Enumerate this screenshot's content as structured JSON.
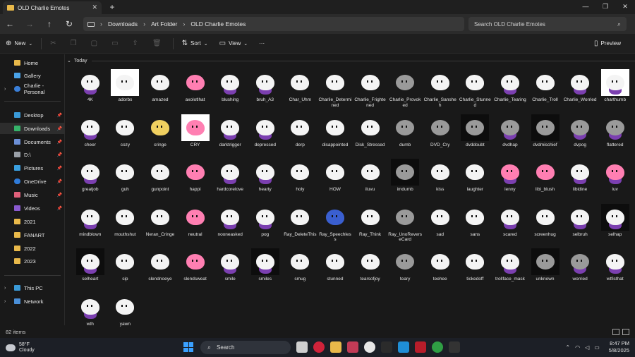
{
  "window": {
    "tab_title": "OLD Charlie Emotes",
    "new_tab": "+",
    "controls": [
      "—",
      "❐",
      "✕"
    ]
  },
  "address": {
    "breadcrumbs": [
      "Downloads",
      "Art Folder",
      "OLD Charlie Emotes"
    ],
    "search_placeholder": "Search OLD Charlie Emotes"
  },
  "toolbar": {
    "new_label": "New",
    "sort_label": "Sort",
    "view_label": "View",
    "more_label": "···",
    "preview_label": "Preview"
  },
  "sidebar": {
    "home": "Home",
    "gallery": "Gallery",
    "onedrive": "Charlie - Personal",
    "quick": [
      "Desktop",
      "Downloads",
      "Documents",
      "D:\\",
      "Pictures",
      "OneDrive",
      "Music",
      "Videos",
      "2021",
      "FANART",
      "2022",
      "2023"
    ],
    "this_pc": "This PC",
    "network": "Network"
  },
  "content": {
    "group_label": "Today",
    "files": [
      "4K",
      "adorbs",
      "amazed",
      "axolotlhat",
      "blushing",
      "bruh_A3",
      "Char_Uhm",
      "Charlie_Determined",
      "Charlie_Frightened",
      "Charlie_Provoked",
      "Charlie_Sansheh",
      "Charlie_Stunned",
      "Charlie_Tearing",
      "Charlie_Troll",
      "Charlie_Worried",
      "charthumb",
      "cheer",
      "cozy",
      "cringe",
      "CRY",
      "darktrigger",
      "depressed",
      "derp",
      "disappointed",
      "Disk_Stressed",
      "dumb",
      "DVD_Cry",
      "dvddoubt",
      "dvdhap",
      "dvdmischief",
      "dvpog",
      "flattered",
      "greatjob",
      "guh",
      "gunpoint",
      "happi",
      "hardcorelove",
      "hearty",
      "holy",
      "HOW",
      "iluvu",
      "imdumb",
      "kiss",
      "laughter",
      "lenny",
      "libi_blush",
      "libidine",
      "luv",
      "mindblown",
      "mouthshut",
      "Neran_Cringe",
      "neutral",
      "nooneasked",
      "pog",
      "Ray_DeleteThis",
      "Ray_Speechless",
      "Ray_Think",
      "Ray_UnoReverseCard",
      "sad",
      "sans",
      "scared",
      "screenhug",
      "selbruh",
      "selhap",
      "selheart",
      "sip",
      "slendnoeye",
      "slendsweat",
      "smile",
      "smiles",
      "smug",
      "stunned",
      "tearsofjoy",
      "teary",
      "teehee",
      "tickedoff",
      "trollface_mask",
      "unknown",
      "worried",
      "wtfisthat",
      "wth",
      "yawn"
    ]
  },
  "status": {
    "count": "82 items"
  },
  "taskbar": {
    "temp": "58°F",
    "condition": "Cloudy",
    "search_label": "Search",
    "time": "8:47 PM",
    "date": "5/8/2025"
  }
}
